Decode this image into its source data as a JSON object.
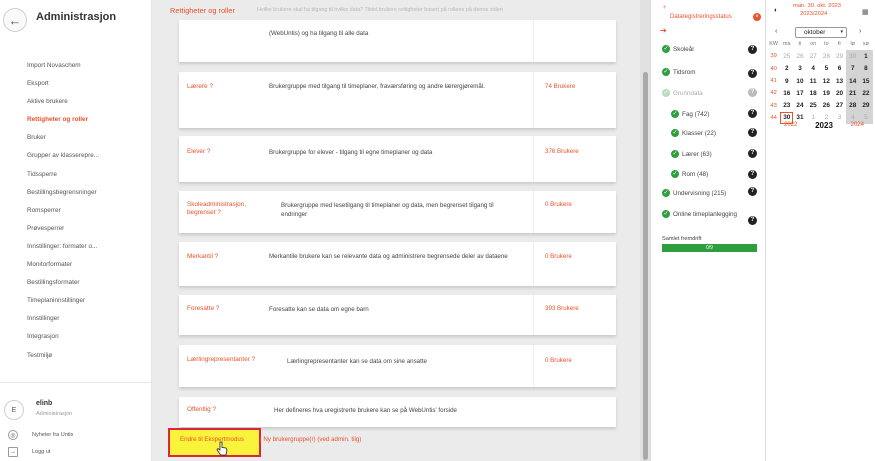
{
  "sidebar": {
    "title": "Administrasjon",
    "items": [
      {
        "label": "Import Novaschem",
        "active": false
      },
      {
        "label": "Eksport",
        "active": false
      },
      {
        "label": "Aktive brukere",
        "active": false
      },
      {
        "label": "Rettigheter og roller",
        "active": true
      },
      {
        "label": "Bruker",
        "active": false
      },
      {
        "label": "Grupper av klasserepre...",
        "active": false
      },
      {
        "label": "Tidssperre",
        "active": false
      },
      {
        "label": "Bestillingsbegrensninger",
        "active": false
      },
      {
        "label": "Romsperrer",
        "active": false
      },
      {
        "label": "Prøvesperrer",
        "active": false
      },
      {
        "label": "Innstillinger: formater o...",
        "active": false
      },
      {
        "label": "Monitorformater",
        "active": false
      },
      {
        "label": "Bestillingsformater",
        "active": false
      },
      {
        "label": "Timeplaninnstillinger",
        "active": false
      },
      {
        "label": "Innstillinger",
        "active": false
      },
      {
        "label": "Integrasjon",
        "active": false
      },
      {
        "label": "Testmiljø",
        "active": false
      }
    ],
    "user": {
      "initial": "E",
      "name": "elinb",
      "role": "Administrasjon"
    },
    "footer": [
      {
        "label": "Nyheter fra Untis",
        "icon": "globe-icon"
      },
      {
        "label": "Logg ut",
        "icon": "logout-icon"
      }
    ]
  },
  "content": {
    "title": "Rettigheter og roller",
    "subtitle": "Hvilke brukere skal ha tilgang til hvilke data? Tildel brukere rettigheter basert på rollene på denne siden",
    "groups": [
      {
        "name": "",
        "description": "(WebUntis) og ha tilgang til alle data",
        "count": ""
      },
      {
        "name": "Lærere ?",
        "description": "Brukergruppe med tilgang til timeplaner, fraværsføring og andre lærergjøremål.",
        "count": "74 Brukere"
      },
      {
        "name": "Elever ?",
        "description": "Brukergruppe for elever - tilgang til egne timeplaner og data",
        "count": "376 Brukere"
      },
      {
        "name": "Skoleadministrasjon, begrenset ?",
        "description": "Brukergruppe med lesetilgang til timeplaner og data, men begrenset tilgang til endringer",
        "count": "0 Brukere"
      },
      {
        "name": "Merkantil ?",
        "description": "Merkantile brukere kan se relevante data og administrere begrensede deler av dataene",
        "count": "0 Brukere"
      },
      {
        "name": "Foresatte ?",
        "description": "Foresatte kan se data om egne barn",
        "count": "393 Brukere"
      },
      {
        "name": "Lærlingrepresentanter ?",
        "description": "Lærlingrepresentanter kan se data om sine ansatte",
        "count": "0 Brukere"
      },
      {
        "name": "Offentlig ?",
        "description": "Her defineres hva uregistrerte brukere kan se på WebUntis' forside",
        "count": ""
      }
    ],
    "bottom_link": "Endre til Ekspertmodus",
    "bottom_rest": "| Ny brukergruppe(r) (ved admin. tilg)"
  },
  "status": {
    "header": "Dataregistreringsstatus",
    "rows": [
      {
        "label": "Skoleår",
        "dim": false
      },
      {
        "label": "Tidsrom",
        "dim": false
      },
      {
        "label": "Grunndata",
        "dim": true
      },
      {
        "label": "Fag (742)",
        "dim": false
      },
      {
        "label": "Klasser (22)",
        "dim": false
      },
      {
        "label": "Lærer (63)",
        "dim": false
      },
      {
        "label": "Rom (48)",
        "dim": false
      },
      {
        "label": "Undervisning (215)",
        "dim": false
      },
      {
        "label": "Online timeplanlegging",
        "dim": false
      }
    ],
    "total_label": "Samlet fremdrift",
    "total_text": "0/9",
    "total_fraction": 1.0
  },
  "calendar": {
    "today_label": "man. 30. okt. 2023",
    "term_label": "2023/2024",
    "month": "oktober",
    "weekday_headers": [
      "KW",
      "ma",
      "ti",
      "on",
      "to",
      "fr",
      "lø",
      "sø"
    ],
    "weeks": [
      {
        "wk": "39",
        "days": [
          "25",
          "26",
          "27",
          "28",
          "29",
          "30",
          "1"
        ],
        "other": [
          true,
          true,
          true,
          true,
          true,
          true,
          false
        ]
      },
      {
        "wk": "40",
        "days": [
          "2",
          "3",
          "4",
          "5",
          "6",
          "7",
          "8"
        ],
        "other": [
          false,
          false,
          false,
          false,
          false,
          false,
          false
        ]
      },
      {
        "wk": "41",
        "days": [
          "9",
          "10",
          "11",
          "12",
          "13",
          "14",
          "15"
        ],
        "other": [
          false,
          false,
          false,
          false,
          false,
          false,
          false
        ]
      },
      {
        "wk": "42",
        "days": [
          "16",
          "17",
          "18",
          "19",
          "20",
          "21",
          "22"
        ],
        "other": [
          false,
          false,
          false,
          false,
          false,
          false,
          false
        ]
      },
      {
        "wk": "43",
        "days": [
          "23",
          "24",
          "25",
          "26",
          "27",
          "28",
          "29"
        ],
        "other": [
          false,
          false,
          false,
          false,
          false,
          false,
          false
        ]
      },
      {
        "wk": "44",
        "days": [
          "30",
          "31",
          "1",
          "2",
          "3",
          "4",
          "5"
        ],
        "other": [
          false,
          false,
          true,
          true,
          true,
          true,
          true
        ]
      }
    ],
    "today_day": "30",
    "years": [
      "2022",
      "2023",
      "2024"
    ]
  },
  "colors": {
    "accent": "#e8532a",
    "success": "#2e9e3e",
    "highlight": "#f9f33c",
    "highlight_border": "#d9263a"
  }
}
